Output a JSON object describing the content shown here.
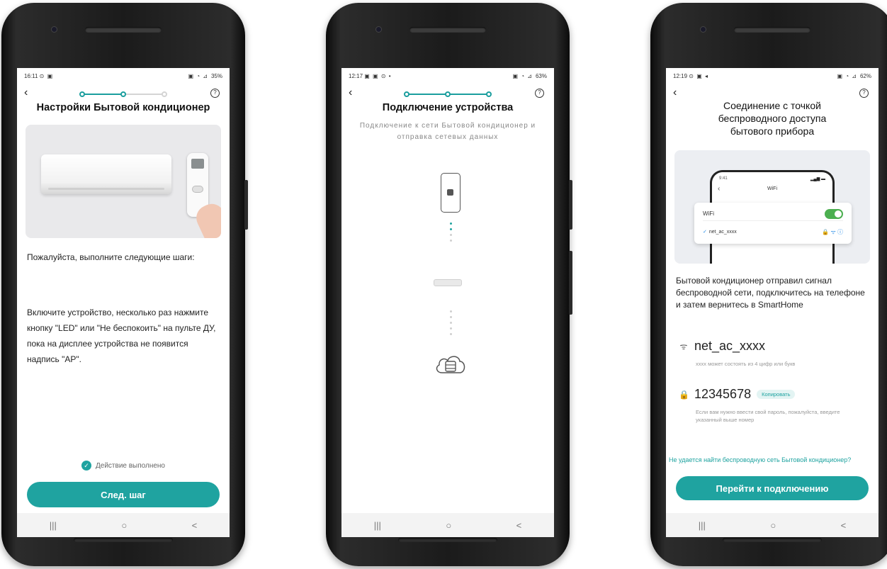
{
  "colors": {
    "accent": "#1fa3a0",
    "toggle_on": "#4caf50"
  },
  "screen1": {
    "status": {
      "time": "16:11",
      "left_icons": "⊙ ▣",
      "right_icons": "▣ ◔ ⊿",
      "battery": "35%"
    },
    "progress": {
      "steps_completed": 2,
      "steps_total": 3
    },
    "title": "Настройки Бытовой кондиционер",
    "instructions_intro": "Пожалуйста, выполните следующие шаги:",
    "instructions_body": "Включите устройство, несколько раз нажмите кнопку \"LED\" или \"Не беспокоить\" на пульте ДУ, пока на дисплее устройства не появится надпись \"AP\".",
    "remote_button_label": "LED",
    "check_label": "Действие выполнено",
    "next_button": "След. шаг"
  },
  "screen2": {
    "status": {
      "time": "12:17",
      "left_icons": "▣ ▣ ⊙ •",
      "right_icons": "▣ ◔ ⊿",
      "battery": "63%"
    },
    "progress": {
      "steps_completed": 3,
      "steps_total": 3
    },
    "title": "Подключение устройства",
    "subtitle": "Подключение к сети Бытовой кондиционер и отправка сетевых данных"
  },
  "screen3": {
    "status": {
      "time": "12:19",
      "left_icons": "⊙ ▣ ◂",
      "right_icons": "▣ ◔ ⊿",
      "battery": "62%"
    },
    "title": "Соединение с точкой беспроводного доступа бытового прибора",
    "illustration": {
      "time": "9:41",
      "header": "WiFi",
      "wifi_label": "WiFi",
      "network": "net_ac_xxxx"
    },
    "description": "Бытовой кондиционер отправил сигнал беспроводной сети, подключитесь на телефоне и затем вернитесь в SmartHome",
    "ssid": "net_ac_xxxx",
    "ssid_hint": "xxxx может состоять из 4 цифр или букв",
    "password": "12345678",
    "copy_label": "Копировать",
    "password_hint": "Если вам нужно ввести свой пароль, пожалуйста, введите указанный выше номер",
    "link": "Не удается найти беспроводную сеть Бытовой кондиционер?",
    "connect_button": "Перейти к подключению"
  },
  "navbar": {
    "recent": "|||",
    "home": "○",
    "back": "<"
  },
  "icons": {
    "back": "chevron-left-icon",
    "help": "help-circle-icon",
    "check": "check-circle-icon",
    "wifi": "wifi-icon",
    "lock": "lock-icon",
    "phone": "phone-icon",
    "cloud": "cloud-server-icon"
  }
}
